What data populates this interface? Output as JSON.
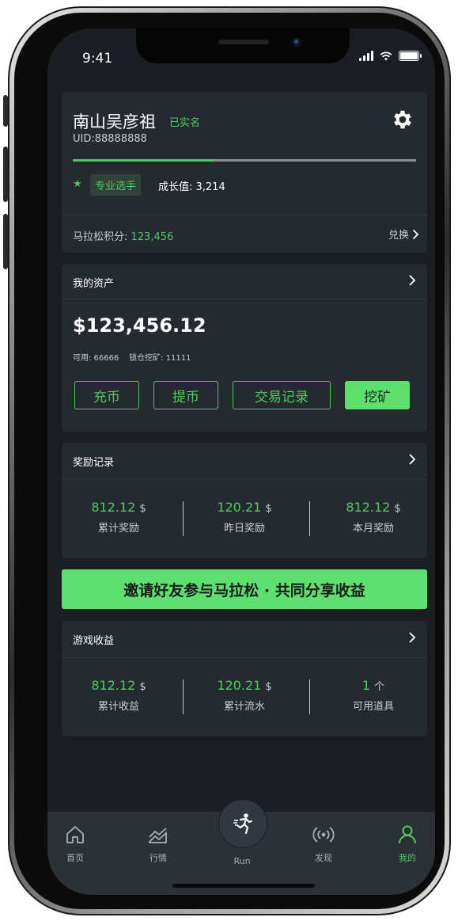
{
  "status_bar": {
    "time": "9:41"
  },
  "profile": {
    "name": "南山吴彦祖",
    "verified": "已实名",
    "uid": "UID:88888888",
    "growth_progress": 0.41,
    "level_badge": "专业选手",
    "growth_label": "成长值: 3,214",
    "points_label": "马拉松积分: ",
    "points_value": "123,456",
    "redeem_label": "兑换"
  },
  "assets": {
    "title": "我的资产",
    "balance": "$123,456.12",
    "available": "可用: 66666    锁仓挖矿: 11111",
    "buttons": {
      "deposit": "充币",
      "withdraw": "提币",
      "history": "交易记录",
      "mining": "挖矿"
    }
  },
  "rewards": {
    "title": "奖励记录",
    "stats": [
      {
        "value": "812.12",
        "unit": "$",
        "label": "累计奖励"
      },
      {
        "value": "120.21",
        "unit": "$",
        "label": "昨日奖励"
      },
      {
        "value": "812.12",
        "unit": "$",
        "label": "本月奖励"
      }
    ]
  },
  "invite_banner": "邀请好友参与马拉松 · 共同分享收益",
  "game": {
    "title": "游戏收益",
    "stats": [
      {
        "value": "812.12",
        "unit": "$",
        "label": "累计收益"
      },
      {
        "value": "120.21",
        "unit": "$",
        "label": "累计流水"
      },
      {
        "value": "1",
        "unit": "个",
        "label": "可用道具"
      }
    ]
  },
  "tabbar": {
    "home": "首页",
    "market": "行情",
    "run": "Run",
    "discover": "发现",
    "mine": "我的"
  },
  "colors": {
    "accent": "#4ecb5d",
    "background": "#1b1f24",
    "card": "#252a31"
  }
}
